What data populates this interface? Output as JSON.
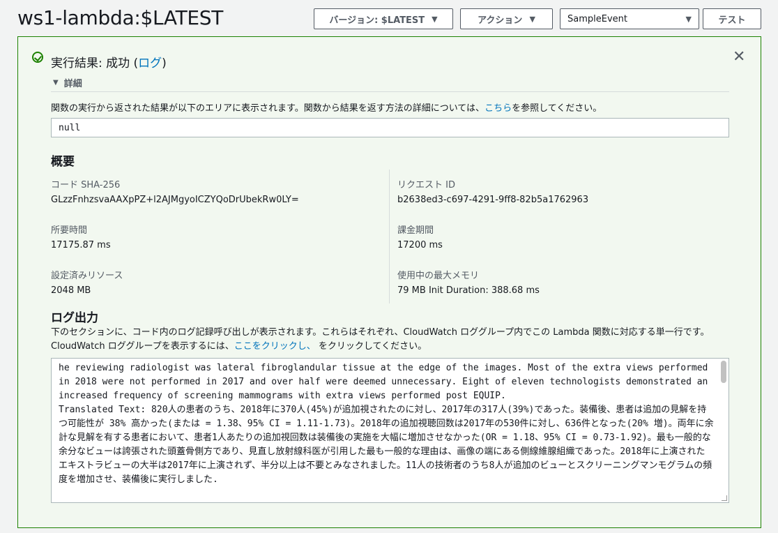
{
  "header": {
    "title": "ws1-lambda:$LATEST",
    "version_button": "バージョン: $LATEST",
    "action_button": "アクション",
    "event_select": "SampleEvent",
    "test_button": "テスト"
  },
  "result": {
    "title_prefix": "実行結果: 成功 (",
    "log_link": "ログ",
    "title_suffix": ")",
    "details_label": "詳細",
    "description_prefix": "関数の実行から返された結果が以下のエリアに表示されます。関数から結果を返す方法の詳細については、",
    "description_link": "こちら",
    "description_suffix": "を参照してください。",
    "output_value": "null"
  },
  "summary": {
    "heading": "概要",
    "code_sha_label": "コード SHA-256",
    "code_sha_value": "GLzzFnhzsvaAAXpPZ+l2AJMgyoICZYQoDrUbekRw0LY=",
    "request_id_label": "リクエスト ID",
    "request_id_value": "b2638ed3-c697-4291-9ff8-82b5a1762963",
    "duration_label": "所要時間",
    "duration_value": "17175.87 ms",
    "billed_label": "課金期間",
    "billed_value": "17200 ms",
    "resources_label": "設定済みリソース",
    "resources_value": "2048 MB",
    "max_memory_label": "使用中の最大メモリ",
    "max_memory_value": "79 MB Init Duration: 388.68 ms"
  },
  "log_output": {
    "heading": "ログ出力",
    "description_prefix": "下のセクションに、コード内のログ記録呼び出しが表示されます。これらはそれぞれ、CloudWatch ロググループ内でこの Lambda 関数に対応する単一行です。CloudWatch ロググループを表示するには、",
    "description_link": "ここをクリックし、",
    "description_suffix": " をクリックしてください。",
    "text": "he reviewing radiologist was lateral fibroglandular tissue at the edge of the images. Most of the extra views performed in 2018 were not performed in 2017 and over half were deemed unnecessary. Eight of eleven technologists demonstrated an increased frequency of screening mammograms with extra views performed post EQUIP.\nTranslated Text: 820人の患者のうち、2018年に370人(45%)が追加視されたのに対し、2017年の317人(39%)であった。装備後、患者は追加の見解を持つ可能性が 38% 高かった(または = 1.38、95% CI = 1.11-1.73)。2018年の追加視聴回数は2017年の530件に対し、636件となった(20% 増)。両年に余計な見解を有する患者において、患者1人あたりの追加視回数は装備後の実施を大幅に増加させなかった(OR = 1.18、95% CI = 0.73-1.92)。最も一般的な余分なビューは誇張された頭蓋骨側方であり、見直し放射線科医が引用した最も一般的な理由は、画像の端にある側線維腺組織であった。2018年に上演されたエキストラビューの大半は2017年に上演されず、半分以上は不要とみなされました。11人の技術者のうち8人が追加のビューとスクリーニングマンモグラムの頻度を増加させ、装備後に実行しました."
  }
}
